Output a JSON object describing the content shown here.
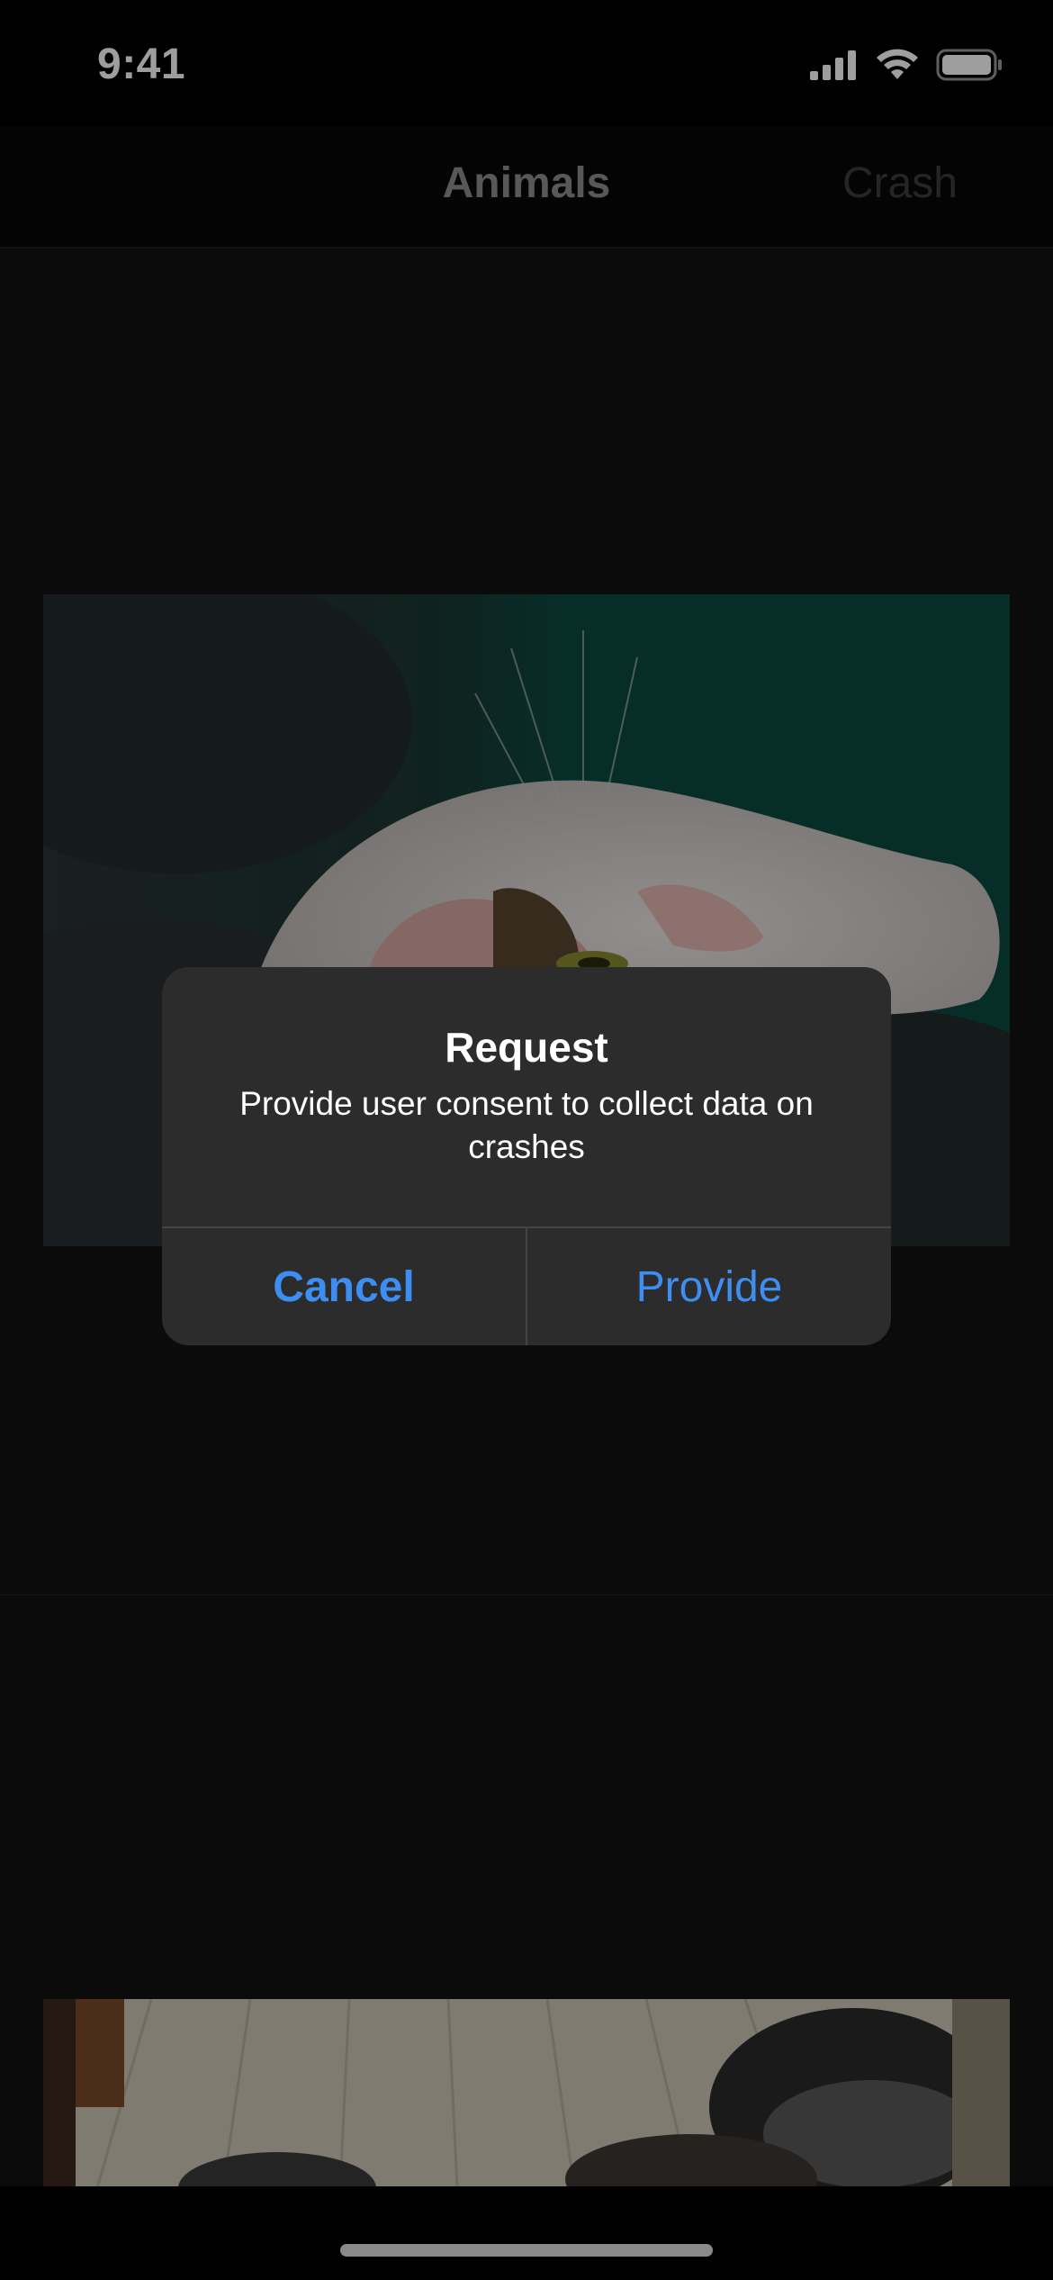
{
  "status_bar": {
    "time": "9:41",
    "icons": [
      "cellular-signal-icon",
      "wifi-icon",
      "battery-icon"
    ]
  },
  "nav": {
    "title": "Animals",
    "right_button": "Crash"
  },
  "content": {
    "images": [
      "cat-photo",
      "cat-photo-partial"
    ]
  },
  "alert": {
    "title": "Request",
    "message": "Provide user consent to collect data on crashes",
    "cancel_label": "Cancel",
    "provide_label": "Provide"
  },
  "colors": {
    "accent": "#3d8ef0",
    "alert_background": "#2c2c2d",
    "content_background": "#121212"
  }
}
